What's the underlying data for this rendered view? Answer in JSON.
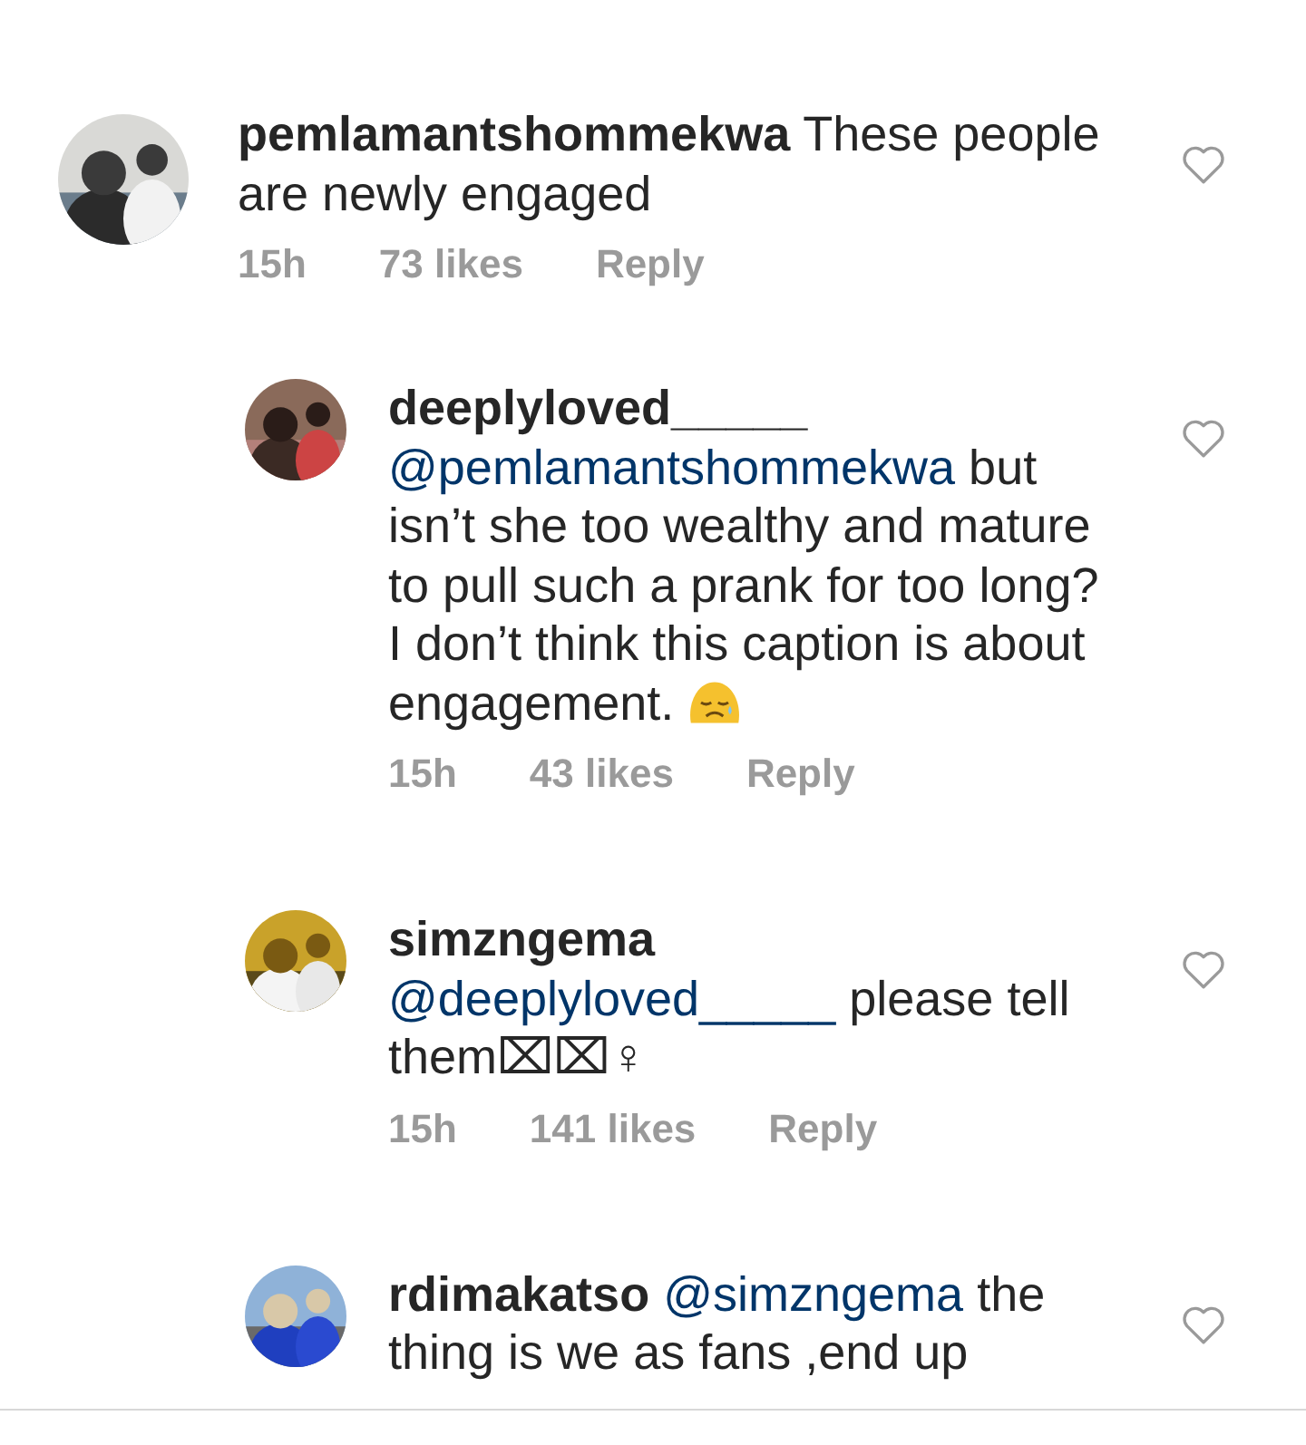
{
  "comments": [
    {
      "kind": "comment",
      "username": "pemlamantshommekwa",
      "text": "These people are newly engaged",
      "time": "15h",
      "likes": "73 likes",
      "reply": "Reply",
      "liked": false
    },
    {
      "kind": "reply",
      "username": "deeplyloved_____",
      "mention": "@pemlamantshommekwa",
      "text": "but isn’t she too wealthy and mature to pull such a prank for too long? I don’t think this caption is about engagement.",
      "emoji": true,
      "time": "15h",
      "likes": "43 likes",
      "reply": "Reply",
      "liked": false
    },
    {
      "kind": "reply",
      "username": "simzngema",
      "mention": "@deeplyloved_____",
      "text": "please tell them⌧⌧♀",
      "time": "15h",
      "likes": "141 likes",
      "reply": "Reply",
      "liked": false
    },
    {
      "kind": "reply",
      "username": "rdimakatso",
      "mention": "@simzngema",
      "text": "the thing is we as fans ,end up",
      "liked": false
    }
  ]
}
